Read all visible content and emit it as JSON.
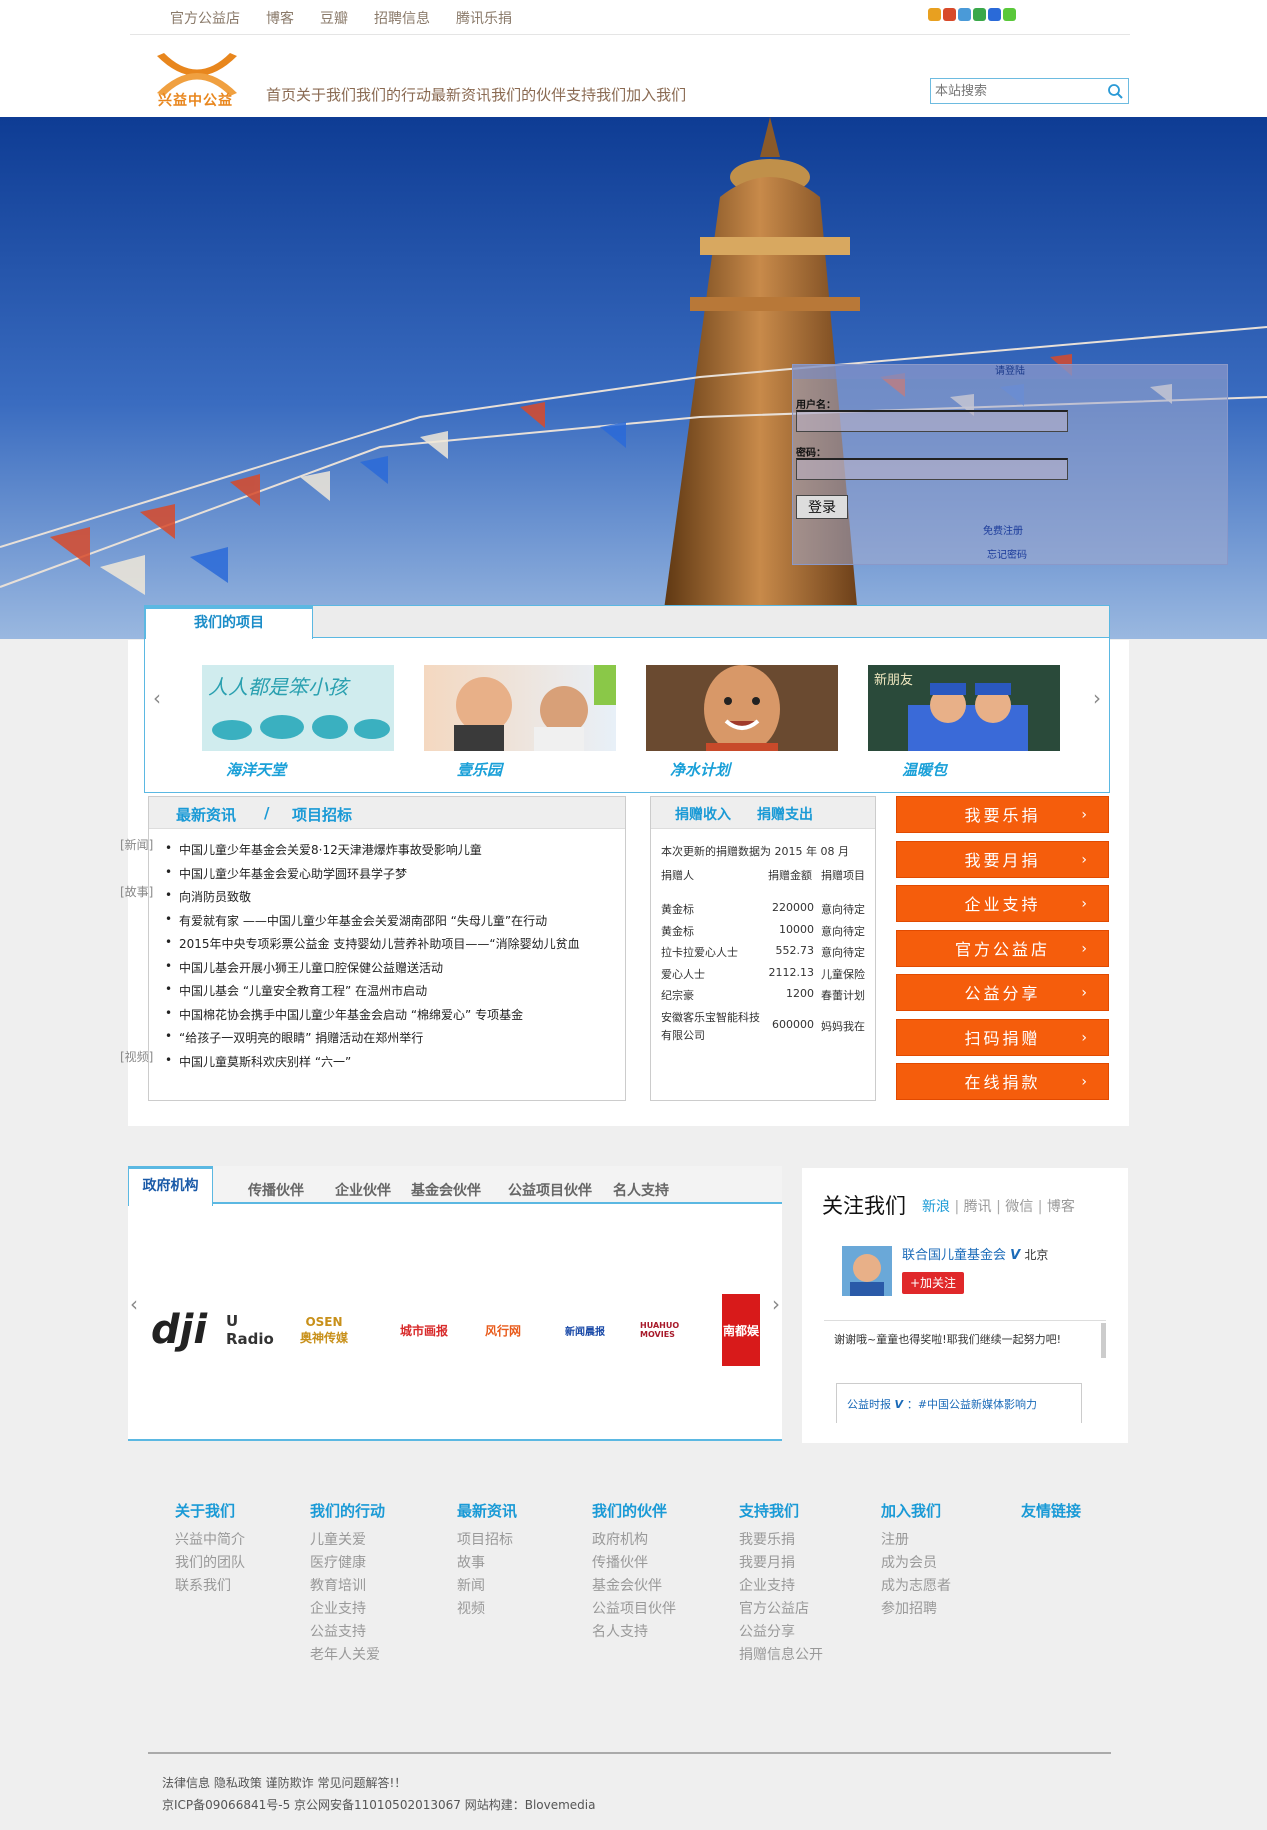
{
  "top_links": [
    "官方公益店",
    "博客",
    "豆瓣",
    "招聘信息",
    "腾讯乐捐"
  ],
  "logo_text": "兴益中公益",
  "main_nav": [
    "首页",
    "关于我们",
    "我们的行动",
    "最新资讯",
    "我们的伙伴",
    "支持我们",
    "加入我们"
  ],
  "search": {
    "placeholder": "本站搜索"
  },
  "login": {
    "title": "请登陆",
    "username_label": "用户名：",
    "password_label": "密码：",
    "login_button": "登录",
    "register_link": "免费注册",
    "forgot_link": "忘记密码"
  },
  "projects": {
    "tab": "我们的项目",
    "items": [
      {
        "name": "海洋天堂",
        "caption": "人人都是笨小孩"
      },
      {
        "name": "壹乐园"
      },
      {
        "name": "净水计划"
      },
      {
        "name": "温暖包",
        "caption": "新朋友"
      }
    ]
  },
  "news": {
    "tab1": "最新资讯",
    "separator": "/",
    "tab2": "项目招标",
    "items": [
      {
        "tag": "[新闻]",
        "text": "中国儿童少年基金会关爱8·12天津港爆炸事故受影响儿童"
      },
      {
        "tag": "",
        "text": "中国儿童少年基金会爱心助学圆环县学子梦"
      },
      {
        "tag": "[故事]",
        "text": "向消防员致敬"
      },
      {
        "tag": "",
        "text": "有爱就有家 ——中国儿童少年基金会关爱湖南邵阳 “失母儿童”在行动"
      },
      {
        "tag": "",
        "text": "2015年中央专项彩票公益金 支持婴幼儿营养补助项目——“消除婴幼儿贫血"
      },
      {
        "tag": "",
        "text": "中国儿基会开展小狮王儿童口腔保健公益赠送活动"
      },
      {
        "tag": "",
        "text": "中国儿基会 “儿童安全教育工程” 在温州市启动"
      },
      {
        "tag": "",
        "text": "中国棉花协会携手中国儿童少年基金会启动 “棉绵爱心” 专项基金"
      },
      {
        "tag": "",
        "text": "“给孩子一双明亮的眼睛” 捐赠活动在郑州举行"
      },
      {
        "tag": "[视频]",
        "text": "中国儿童莫斯科欢庆别样 “六一”"
      }
    ]
  },
  "donation": {
    "tab1": "捐赠收入",
    "tab2": "捐赠支出",
    "summary": "本次更新的捐赠数据为 2015 年 08 月",
    "headers": [
      "捐赠人",
      "捐赠金额",
      "捐赠项目"
    ],
    "rows": [
      {
        "donor": "黄金标",
        "amount": "220000",
        "project": "意向待定"
      },
      {
        "donor": "黄金标",
        "amount": "10000",
        "project": "意向待定"
      },
      {
        "donor": "拉卡拉爱心人士",
        "amount": "552.73",
        "project": "意向待定"
      },
      {
        "donor": "爱心人士",
        "amount": "2112.13",
        "project": "儿童保险"
      },
      {
        "donor": "纪宗豪",
        "amount": "1200",
        "project": "春蕾计划"
      },
      {
        "donor": "安徽客乐宝智能科技有限公司",
        "amount": "600000",
        "project": "妈妈我在"
      }
    ]
  },
  "actions": [
    "我要乐捐",
    "我要月捐",
    "企业支持",
    "官方公益店",
    "公益分享",
    "扫码捐赠",
    "在线捐款"
  ],
  "partners": {
    "tabs": [
      "政府机构",
      "传播伙伴",
      "企业伙伴",
      "基金会伙伴",
      "公益项目伙伴",
      "名人支持"
    ],
    "logos": [
      "dji",
      "U Radio",
      "OSEN 奥神传媒",
      "城市画报",
      "风行网",
      "新闻晨报",
      "HUAHUO MOVIES",
      "南都娱"
    ]
  },
  "follow": {
    "title": "关注我们",
    "tabs": [
      "新浪",
      "腾讯",
      "微信",
      "博客"
    ],
    "account": "联合国儿童基金会",
    "location": "北京",
    "follow_button": "+加关注",
    "post": "谢谢哦~童童也得奖啦!耶我们继续一起努力吧!",
    "quote_author": "公益时报",
    "quote_text": "：#中国公益新媒体影响力"
  },
  "footer_cols": [
    {
      "title": "关于我们",
      "links": [
        "兴益中简介",
        "我们的团队",
        "联系我们"
      ]
    },
    {
      "title": "我们的行动",
      "links": [
        "儿童关爱",
        "医疗健康",
        "教育培训",
        "企业支持",
        "公益支持",
        "老年人关爱"
      ]
    },
    {
      "title": "最新资讯",
      "links": [
        "项目招标",
        "故事",
        "新闻",
        "视频"
      ]
    },
    {
      "title": "我们的伙伴",
      "links": [
        "政府机构",
        "传播伙伴",
        "基金会伙伴",
        "公益项目伙伴",
        "名人支持"
      ]
    },
    {
      "title": "支持我们",
      "links": [
        "我要乐捐",
        "我要月捐",
        "企业支持",
        "官方公益店",
        "公益分享",
        "捐赠信息公开"
      ]
    },
    {
      "title": "加入我们",
      "links": [
        "注册",
        "成为会员",
        "成为志愿者",
        "参加招聘"
      ]
    },
    {
      "title": "友情链接",
      "links": []
    }
  ],
  "footer": {
    "line1": "法律信息 隐私政策 谨防欺诈 常见问题解答!！",
    "line2": "京ICP备09066841号-5    京公网安备11010502013067     网站构建：Blovemedia"
  },
  "colors": {
    "accent": "#1a9ad6",
    "orange": "#f55d0c",
    "brand": "#e8861d"
  }
}
